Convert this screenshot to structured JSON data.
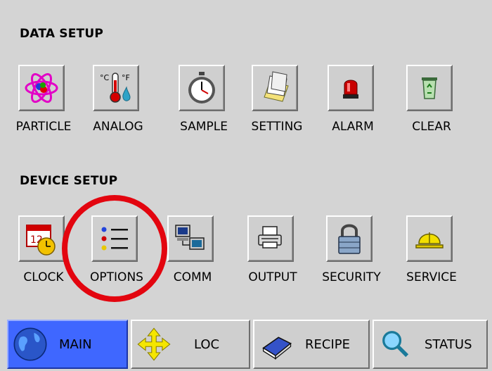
{
  "sections": {
    "data_setup_title": "DATA SETUP",
    "device_setup_title": "DEVICE SETUP"
  },
  "data_setup": [
    {
      "label": "PARTICLE",
      "icon": "atom-icon"
    },
    {
      "label": "ANALOG",
      "icon": "thermometer-icon"
    },
    {
      "label": "SAMPLE",
      "icon": "stopwatch-icon"
    },
    {
      "label": "SETTING",
      "icon": "papers-icon"
    },
    {
      "label": "ALARM",
      "icon": "alarm-light-icon"
    },
    {
      "label": "CLEAR",
      "icon": "recycle-bin-icon"
    }
  ],
  "device_setup": [
    {
      "label": "CLOCK",
      "icon": "calendar-clock-icon"
    },
    {
      "label": "OPTIONS",
      "icon": "list-icon"
    },
    {
      "label": "COMM",
      "icon": "computers-icon"
    },
    {
      "label": "OUTPUT",
      "icon": "printer-icon"
    },
    {
      "label": "SECURITY",
      "icon": "padlock-icon"
    },
    {
      "label": "SERVICE",
      "icon": "hard-hat-icon"
    }
  ],
  "nav": [
    {
      "label": "MAIN",
      "icon": "globe-icon",
      "active": true
    },
    {
      "label": "LOC",
      "icon": "move-arrows-icon",
      "active": false
    },
    {
      "label": "RECIPE",
      "icon": "book-icon",
      "active": false
    },
    {
      "label": "STATUS",
      "icon": "magnifier-icon",
      "active": false
    }
  ],
  "colors": {
    "background": "#d4d4d4",
    "active_tab": "#3f67ff",
    "highlight_circle": "#e3050f"
  }
}
